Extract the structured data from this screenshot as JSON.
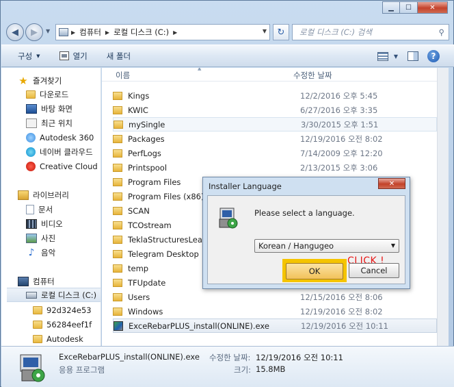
{
  "window": {
    "minimize_glyph": "▁",
    "maximize_glyph": "☐",
    "close_glyph": "✕"
  },
  "address": {
    "back_glyph": "◀",
    "forward_glyph": "▶",
    "segments": [
      "컴퓨터",
      "로컬 디스크 (C:)"
    ],
    "separator_glyph": "▶",
    "search_placeholder": "로컬 디스크 (C:) 검색",
    "search_glyph": "⚲",
    "refresh_glyph": "↻"
  },
  "toolbar": {
    "organize_label": "구성",
    "open_label": "열기",
    "new_folder_label": "새 폴더",
    "help_glyph": "?"
  },
  "nav_pane": {
    "favorites": "즐겨찾기",
    "favorites_items": [
      "다운로드",
      "바탕 화면",
      "최근 위치",
      "Autodesk 360",
      "네이버 클라우드",
      "Creative Cloud"
    ],
    "libraries": "라이브러리",
    "library_items": [
      "문서",
      "비디오",
      "사진",
      "음악"
    ],
    "computer": "컴퓨터",
    "drive": "로컬 디스크 (C:)",
    "drive_folders": [
      "92d324e53",
      "56284eef1f",
      "Autodesk"
    ]
  },
  "columns": {
    "name": "이름",
    "modified": "수정한 날짜"
  },
  "files": [
    {
      "name": "Kings",
      "date": "12/2/2016 오후 5:45",
      "type": "folder"
    },
    {
      "name": "KWIC",
      "date": "6/27/2016 오후 3:35",
      "type": "folder"
    },
    {
      "name": "mySingle",
      "date": "3/30/2015 오후 1:51",
      "type": "folder"
    },
    {
      "name": "Packages",
      "date": "12/19/2016 오전 8:02",
      "type": "folder"
    },
    {
      "name": "PerfLogs",
      "date": "7/14/2009 오후 12:20",
      "type": "folder"
    },
    {
      "name": "Printspool",
      "date": "2/13/2015 오후 3:06",
      "type": "folder"
    },
    {
      "name": "Program Files",
      "date": "",
      "type": "folder"
    },
    {
      "name": "Program Files (x86)",
      "date": "",
      "type": "folder"
    },
    {
      "name": "SCAN",
      "date": "",
      "type": "folder"
    },
    {
      "name": "TCOstream",
      "date": "",
      "type": "folder"
    },
    {
      "name": "TeklaStructuresLearn",
      "date": "",
      "type": "folder"
    },
    {
      "name": "Telegram Desktop",
      "date": "",
      "type": "folder"
    },
    {
      "name": "temp",
      "date": "",
      "type": "folder"
    },
    {
      "name": "TFUpdate",
      "date": "",
      "type": "folder"
    },
    {
      "name": "Users",
      "date": "12/15/2016 오전 8:06",
      "type": "folder"
    },
    {
      "name": "Windows",
      "date": "12/19/2016 오전 8:02",
      "type": "folder"
    },
    {
      "name": "ExceRebarPLUS_install(ONLINE).exe",
      "date": "12/19/2016 오전 10:11",
      "type": "exe"
    }
  ],
  "details": {
    "file_name": "ExceRebarPLUS_install(ONLINE).exe",
    "file_type": "응용 프로그램",
    "modified_key": "수정한 날짜:",
    "modified_value": "12/19/2016 오전 10:11",
    "size_key": "크기:",
    "size_value": "15.8MB"
  },
  "dialog": {
    "title": "Installer Language",
    "close_glyph": "✕",
    "message": "Please select a language.",
    "selected_language": "Korean / Hangugeo",
    "dropdown_glyph": "▼",
    "ok_label": "OK",
    "cancel_label": "Cancel",
    "annotation": "CLICK !"
  }
}
